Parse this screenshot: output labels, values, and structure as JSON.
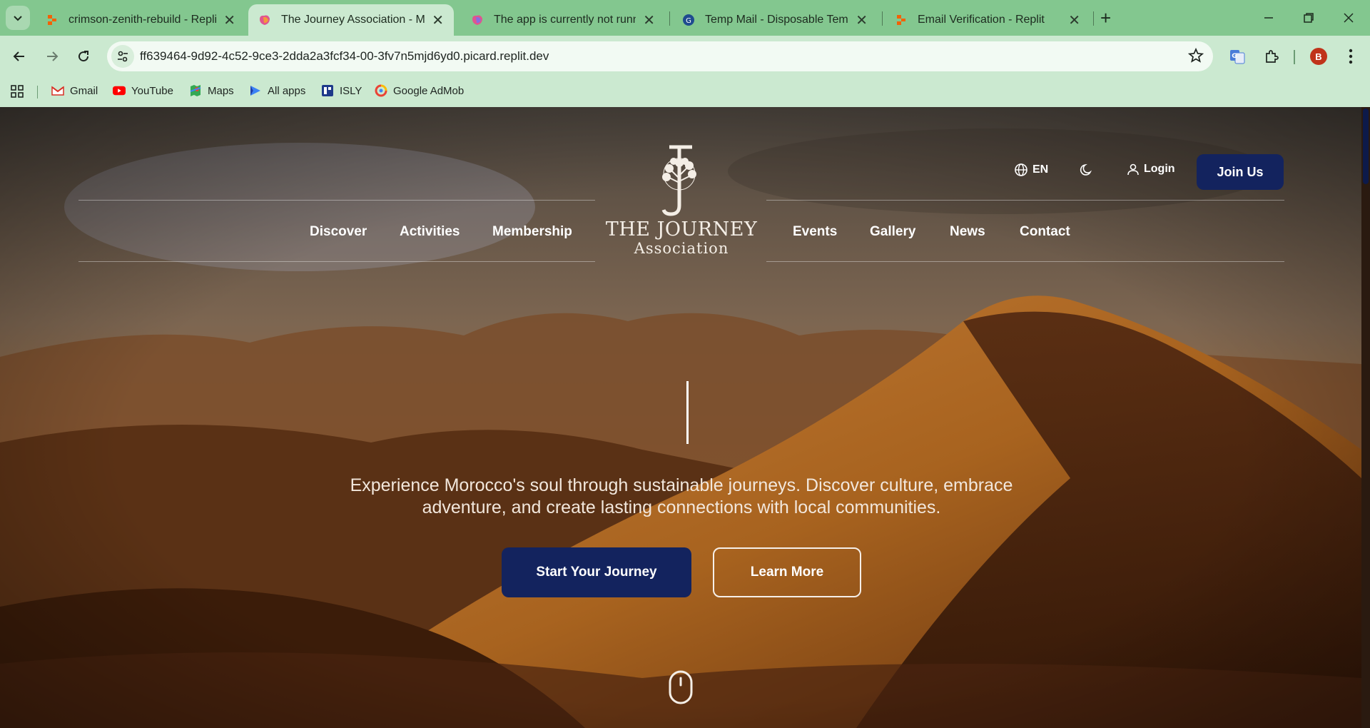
{
  "browser": {
    "tabs": [
      {
        "title": "crimson-zenith-rebuild - Replit",
        "favicon": "replit-icon",
        "active": false
      },
      {
        "title": "The Journey Association - Morocco",
        "favicon": "journey-favicon-icon",
        "active": true
      },
      {
        "title": "The app is currently not running",
        "favicon": "journey-favicon-icon",
        "active": false
      },
      {
        "title": "Temp Mail - Disposable Temporary Email",
        "favicon": "tempmail-icon",
        "active": false
      },
      {
        "title": "Email Verification - Replit",
        "favicon": "replit-icon",
        "active": false
      }
    ],
    "url": "ff639464-9d92-4c52-9ce3-2dda2a3fcf34-00-3fv7n5mjd6yd0.picard.replit.dev",
    "profile_initial": "B",
    "bookmarks": [
      {
        "label": "Gmail",
        "icon": "gmail-icon"
      },
      {
        "label": "YouTube",
        "icon": "youtube-icon"
      },
      {
        "label": "Maps",
        "icon": "maps-icon"
      },
      {
        "label": "All apps",
        "icon": "all-apps-icon"
      },
      {
        "label": "ISLY",
        "icon": "isly-icon"
      },
      {
        "label": "Google AdMob",
        "icon": "admob-icon"
      }
    ]
  },
  "site": {
    "logo": {
      "name": "THE JOURNEY",
      "sub": "Association"
    },
    "nav_left": [
      "Discover",
      "Activities",
      "Membership"
    ],
    "nav_right": [
      "Events",
      "Gallery",
      "News",
      "Contact"
    ],
    "language": "EN",
    "login": "Login",
    "join": "Join Us",
    "hero_text": "Experience Morocco's soul through sustainable journeys. Discover culture, embrace adventure, and create lasting connections with local communities.",
    "cta_primary": "Start Your Journey",
    "cta_secondary": "Learn More"
  },
  "colors": {
    "tab_bar": "#83c78f",
    "toolbar": "#cbe9d0",
    "brand_navy": "#13235e",
    "hero_sand": "#9a5d27"
  }
}
